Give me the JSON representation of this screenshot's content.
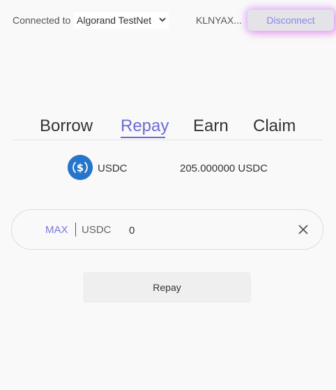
{
  "header": {
    "connected_label": "Connected to",
    "network": "Algorand TestNet",
    "account": "KLNYAX...",
    "disconnect_label": "Disconnect"
  },
  "tabs": [
    {
      "label": "Borrow",
      "active": false
    },
    {
      "label": "Repay",
      "active": true
    },
    {
      "label": "Earn",
      "active": false
    },
    {
      "label": "Claim",
      "active": false
    }
  ],
  "asset": {
    "icon": "usdc-icon",
    "name": "USDC",
    "balance": "205.000000 USDC"
  },
  "input": {
    "max_label": "MAX",
    "unit": "USDC",
    "value": "0"
  },
  "action": {
    "repay_label": "Repay"
  },
  "colors": {
    "accent": "#6b6bd6",
    "usdc_blue": "#2775ca"
  }
}
